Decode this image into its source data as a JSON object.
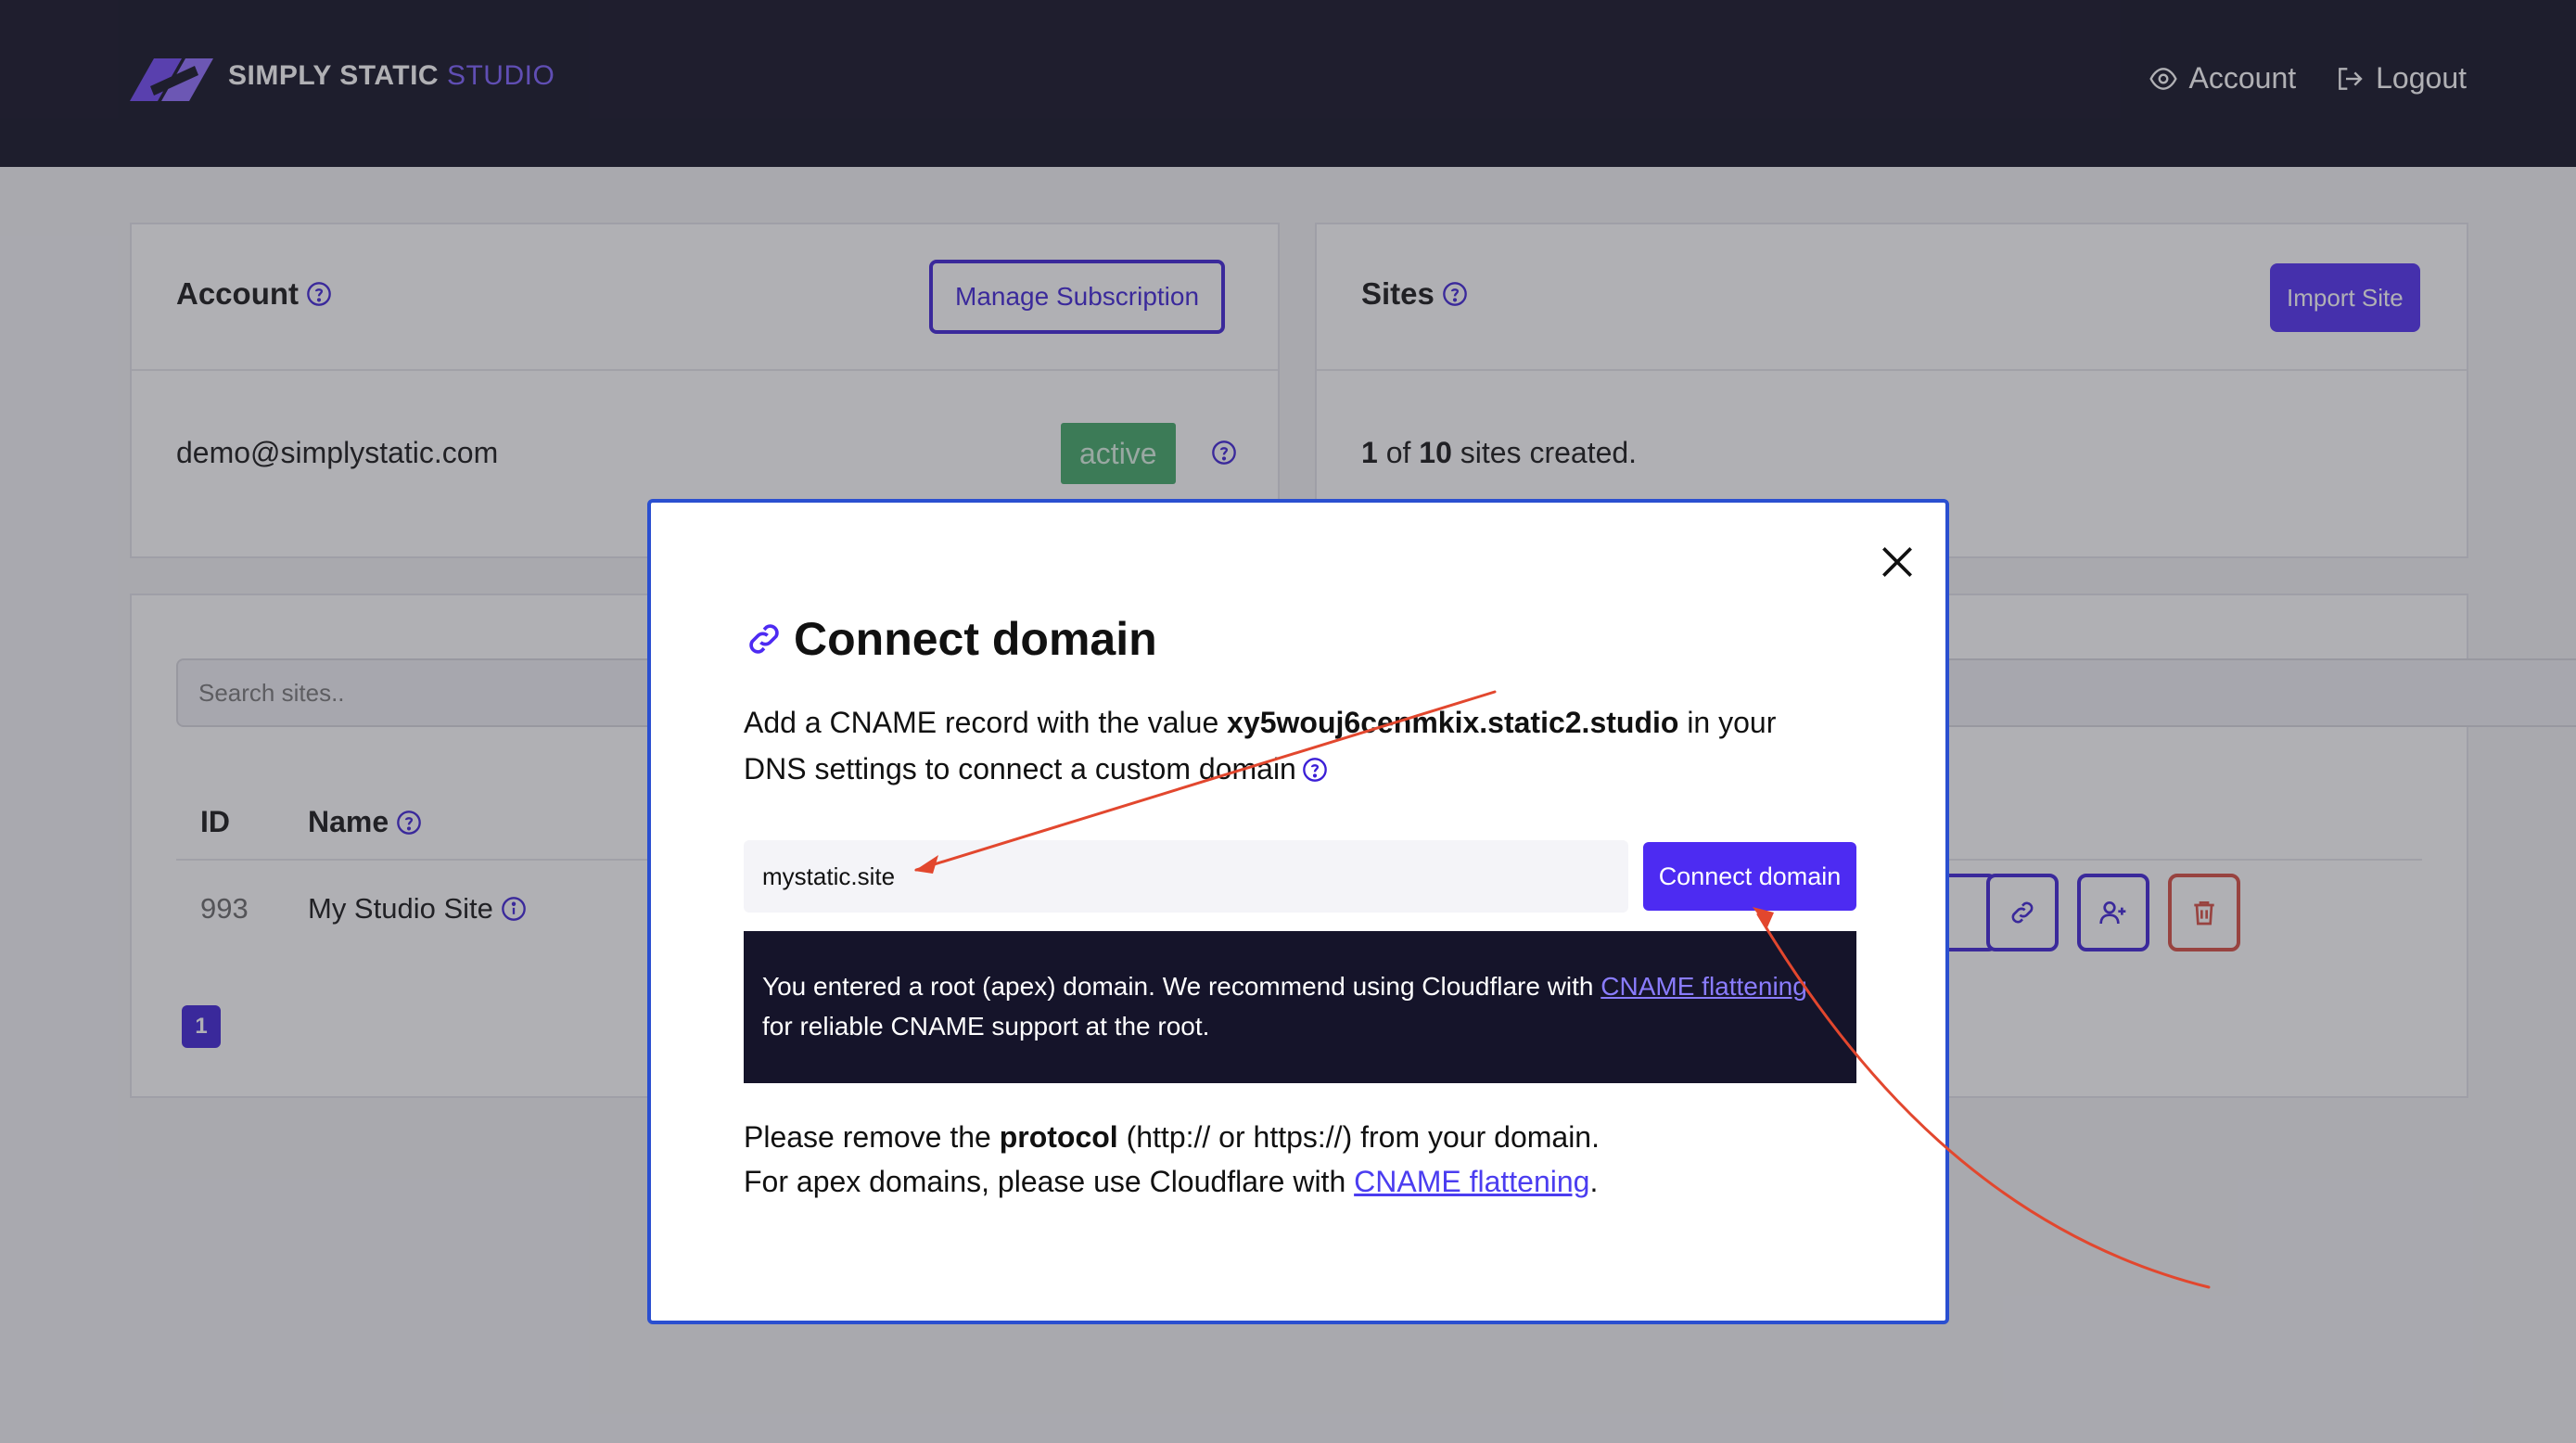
{
  "brand": {
    "name": "SIMPLY STATIC",
    "accent": "STUDIO"
  },
  "topnav": {
    "account": "Account",
    "logout": "Logout"
  },
  "account_card": {
    "title": "Account",
    "manage_button": "Manage Subscription",
    "email": "demo@simplystatic.com",
    "status": "active"
  },
  "sites_card": {
    "title": "Sites",
    "import_button": "Import Site",
    "count_used": "1",
    "of": "of",
    "count_total": "10",
    "count_suffix": "sites created."
  },
  "sites_table": {
    "search_placeholder": "Search sites..",
    "col_id": "ID",
    "col_name": "Name",
    "rows": [
      {
        "id": "993",
        "name": "My Studio Site"
      }
    ],
    "page": "1"
  },
  "modal": {
    "title": "Connect domain",
    "desc_prefix": "Add a CNAME record with the value",
    "cname_value": "xy5wouj6cenmkix.static2.studio",
    "desc_suffix": "in your DNS settings to connect a custom domain",
    "input_value": "mystatic.site",
    "connect_button": "Connect domain",
    "notice_prefix": "You entered a root (apex) domain. We recommend using Cloudflare with",
    "notice_link": "CNAME flattening",
    "notice_suffix": "for reliable CNAME support at the root.",
    "foot1_prefix": "Please remove the",
    "foot1_bold": "protocol",
    "foot1_suffix": "(http:// or https://) from your domain.",
    "foot2_prefix": "For apex domains, please use Cloudflare with",
    "foot2_link": "CNAME flattening",
    "foot2_suffix": "."
  },
  "colors": {
    "header_bg": "#0d0c1f",
    "accent": "#4d2bf2",
    "active_badge": "#3ea765",
    "danger": "#d84a3e",
    "annotation_arrow": "#e2472e"
  }
}
